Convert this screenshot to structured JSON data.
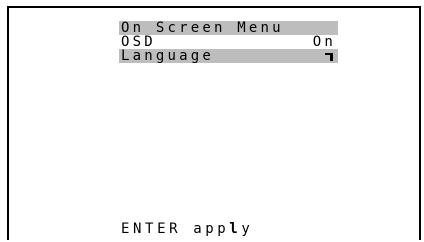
{
  "menu": {
    "title": "On Screen Menu",
    "items": [
      {
        "label": "OSD",
        "value": "On"
      },
      {
        "label": "Language",
        "icon": "submenu-arrow-icon"
      }
    ]
  },
  "footer": {
    "key": "ENTER",
    "action_pre": "app",
    "action_emph": "l",
    "action_post": "y"
  },
  "colors": {
    "background": "#ffffff",
    "text": "#000000",
    "highlight": "#bdbdbd"
  }
}
